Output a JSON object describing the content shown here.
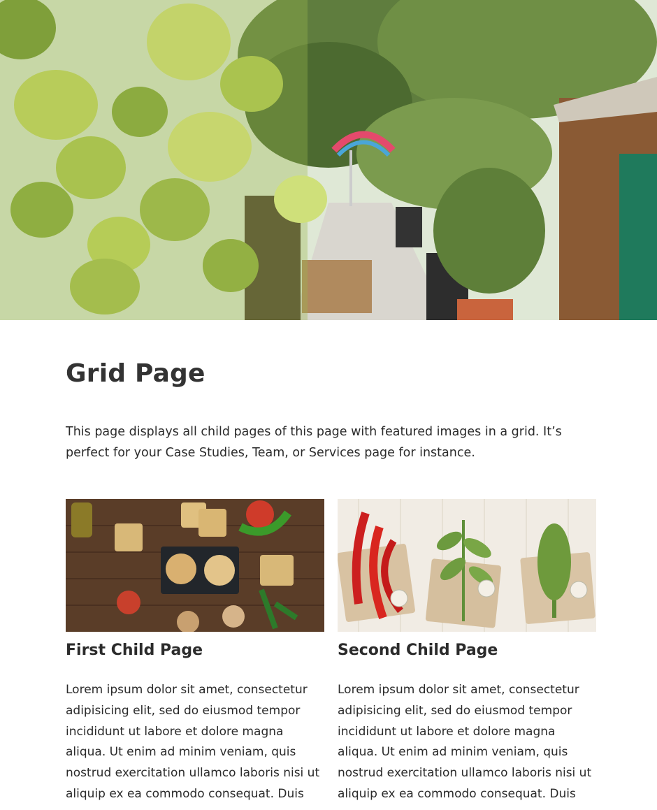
{
  "page": {
    "title": "Grid Page",
    "intro": "This page displays all child pages of this page with featured images in a grid. It’s perfect for your Case Studies, Team, or Services page for instance."
  },
  "hero": {
    "image": "garden-cafe-with-heart-shaped-leaves"
  },
  "children": [
    {
      "title": "First Child Page",
      "image": "toasts-tomatoes-olive-oil-on-wooden-table",
      "excerpt": "Lorem ipsum dolor sit amet, consectetur adipisicing elit, sed do eiusmod tempor incididunt ut labore et dolore magna aliqua. Ut enim ad minim veniam, quis nostrud exercitation ullamco laboris nisi ut aliquip ex ea commodo consequat. Duis"
    },
    {
      "title": "Second Child Page",
      "image": "chili-peppers-and-herbs-on-white-wood",
      "excerpt": "Lorem ipsum dolor sit amet, consectetur adipisicing elit, sed do eiusmod tempor incididunt ut labore et dolore magna aliqua. Ut enim ad minim veniam, quis nostrud exercitation ullamco laboris nisi ut aliquip ex ea commodo consequat. Duis"
    }
  ]
}
